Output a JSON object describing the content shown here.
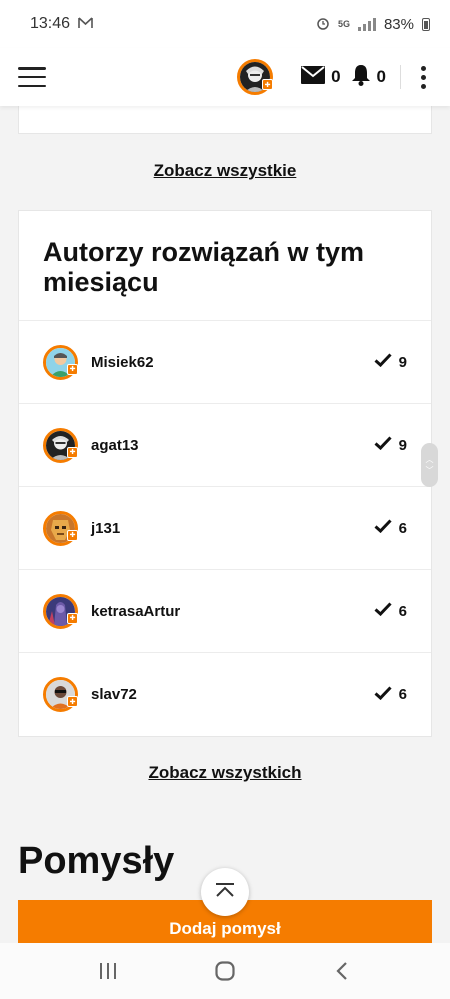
{
  "statusbar": {
    "time": "13:46",
    "network": "5G",
    "battery": "83%"
  },
  "header": {
    "messages_count": "0",
    "notifications_count": "0"
  },
  "links": {
    "see_all_prev": "Zobacz wszystkie",
    "see_all_authors": "Zobacz wszystkich"
  },
  "authors_card": {
    "title": "Autorzy rozwiązań w tym miesiącu",
    "rows": [
      {
        "name": "Misiek62",
        "count": "9"
      },
      {
        "name": "agat13",
        "count": "9"
      },
      {
        "name": "j131",
        "count": "6"
      },
      {
        "name": "ketrasaArtur",
        "count": "6"
      },
      {
        "name": "slav72",
        "count": "6"
      }
    ]
  },
  "ideas": {
    "title": "Pomysły",
    "add_button": "Dodaj pomysł"
  },
  "colors": {
    "accent": "#f57c00",
    "background": "#f3f3f3"
  },
  "icons": [
    "hamburger-menu-icon",
    "envelope-icon",
    "bell-icon",
    "more-vertical-icon",
    "checkmark-icon",
    "chevron-up-icon",
    "recent-apps-icon",
    "home-icon",
    "back-icon"
  ]
}
